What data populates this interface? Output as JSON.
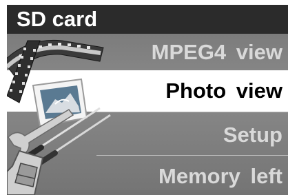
{
  "screen": {
    "title": "SD card",
    "menu": [
      {
        "label": "MPEG4  view",
        "icon": "film-strip-icon",
        "selected": false
      },
      {
        "label": "Photo  view",
        "icon": "photo-frame-icon",
        "selected": true
      },
      {
        "label": "Setup",
        "icon": "tools-icon",
        "selected": false
      },
      {
        "label": "Memory  left",
        "icon": "sd-card-icon",
        "selected": false
      }
    ]
  },
  "colors": {
    "title_bar": "#2b2b2b",
    "menu_background": "#808080",
    "selected_background": "#ffffff",
    "selected_text": "#000000",
    "unselected_text": "#d9d9d9"
  }
}
